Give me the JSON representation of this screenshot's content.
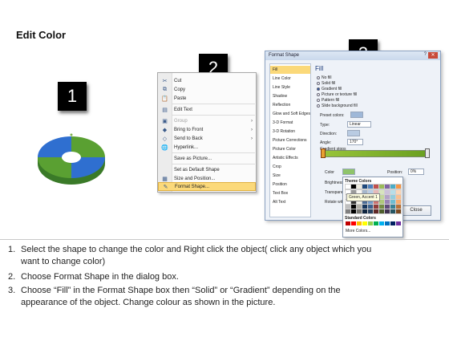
{
  "page": {
    "title": "Edit Color"
  },
  "steps": [
    "1",
    "2",
    "3"
  ],
  "context_menu": {
    "items": [
      {
        "icon": "✂",
        "label": "Cut",
        "arrow": "",
        "disabled": false,
        "highlight": false
      },
      {
        "icon": "⧉",
        "label": "Copy",
        "arrow": "",
        "disabled": false,
        "highlight": false
      },
      {
        "icon": "📋",
        "label": "Paste",
        "arrow": "",
        "disabled": false,
        "highlight": false
      },
      {
        "icon": "▤",
        "label": "Edit Text",
        "arrow": "",
        "disabled": false,
        "highlight": false
      },
      {
        "icon": "▣",
        "label": "Group",
        "arrow": "›",
        "disabled": true,
        "highlight": false
      },
      {
        "icon": "◆",
        "label": "Bring to Front",
        "arrow": "›",
        "disabled": false,
        "highlight": false
      },
      {
        "icon": "◇",
        "label": "Send to Back",
        "arrow": "›",
        "disabled": false,
        "highlight": false
      },
      {
        "icon": "🌐",
        "label": "Hyperlink...",
        "arrow": "",
        "disabled": false,
        "highlight": false
      },
      {
        "icon": "",
        "label": "Save as Picture...",
        "arrow": "",
        "disabled": false,
        "highlight": false
      },
      {
        "icon": "",
        "label": "Set as Default Shape",
        "arrow": "",
        "disabled": false,
        "highlight": false
      },
      {
        "icon": "▦",
        "label": "Size and Position...",
        "arrow": "",
        "disabled": false,
        "highlight": false
      },
      {
        "icon": "✎",
        "label": "Format Shape...",
        "arrow": "",
        "disabled": false,
        "highlight": true
      }
    ]
  },
  "format_dialog": {
    "title": "Format Shape",
    "help": "?",
    "close": "✕",
    "categories": [
      "Fill",
      "Line Color",
      "Line Style",
      "Shadow",
      "Reflection",
      "Glow and Soft Edges",
      "3-D Format",
      "3-D Rotation",
      "Picture Corrections",
      "Picture Color",
      "Artistic Effects",
      "Crop",
      "Size",
      "Position",
      "Text Box",
      "Alt Text"
    ],
    "selected_category": "Fill",
    "panel_title": "Fill",
    "fill_options": [
      {
        "label": "No fill",
        "on": false
      },
      {
        "label": "Solid fill",
        "on": false
      },
      {
        "label": "Gradient fill",
        "on": true
      },
      {
        "label": "Picture or texture fill",
        "on": false
      },
      {
        "label": "Pattern fill",
        "on": false
      },
      {
        "label": "Slide background fill",
        "on": false
      }
    ],
    "fields": {
      "preset_colors_label": "Preset colors:",
      "type_label": "Type:",
      "type_value": "Linear",
      "direction_label": "Direction:",
      "angle_label": "Angle:",
      "angle_value": "170°",
      "gradient_stops_label": "Gradient stops",
      "color_label": "Color",
      "position_label": "Position:",
      "position_value": "0%",
      "brightness_label": "Brightness",
      "transparency_label": "Transparency",
      "rotate_label": "Rotate with shape"
    },
    "close_button": "Close"
  },
  "color_palette": {
    "theme_header": "Theme Colors",
    "tooltip": "Green, Accent 1",
    "standard_header": "Standard Colors",
    "more": "More Colors...",
    "theme_top": [
      "#ffffff",
      "#000000",
      "#eeece1",
      "#1f497d",
      "#4f81bd",
      "#c0504d",
      "#9bbb59",
      "#8064a2",
      "#4bacc6",
      "#f79646"
    ],
    "standard": [
      "#c00000",
      "#ff0000",
      "#ffc000",
      "#ffff00",
      "#92d050",
      "#00b050",
      "#00b0f0",
      "#0070c0",
      "#002060",
      "#7030a0"
    ]
  },
  "instructions": [
    {
      "num": "1.",
      "lines": [
        "Select the shape to change the color and Right click the object( click any object which you",
        "want to change color)"
      ]
    },
    {
      "num": "2.",
      "lines": [
        "Choose Format Shape in the dialog box."
      ]
    },
    {
      "num": "3.",
      "lines": [
        "Choose “Fill” in the Format Shape box then “Solid” or “Gradient” depending on the",
        "appearance of the object. Change colour as shown in the picture."
      ]
    }
  ]
}
